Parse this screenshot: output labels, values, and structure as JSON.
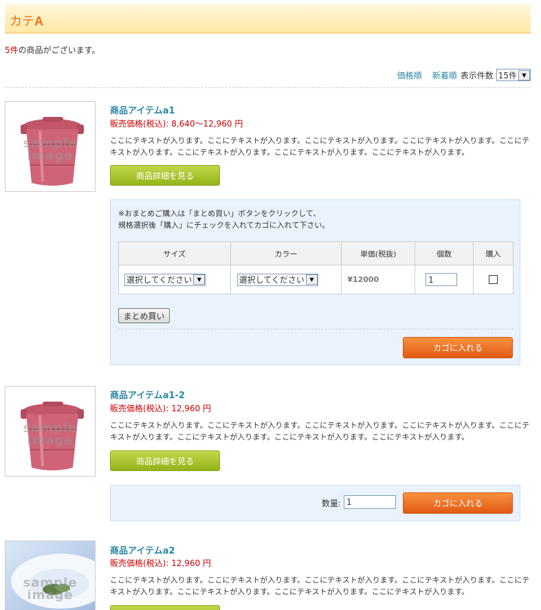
{
  "category": {
    "title_main": "カテ",
    "title_bold": "A"
  },
  "listing": {
    "count": "5件",
    "count_suffix": "の商品がございます。"
  },
  "sort": {
    "price_order": "価格順",
    "new_order": "新着順",
    "display_count_label": "表示件数",
    "display_count_value": "15件"
  },
  "products": [
    {
      "name": "商品アイテムa1",
      "price": "販売価格(税込): 8,640～12,960 円",
      "description": "ここにテキストが入ります。ここにテキストが入ります。ここにテキストが入ります。ここにテキストが入ります。ここにテキストが入ります。ここにテキストが入ります。ここにテキストが入ります。ここにテキストが入ります。",
      "detail_button": "商品詳細を見る",
      "image_watermark": [
        "sample",
        "image"
      ],
      "notice_line1": "※おまとめご購入は「まとめ買い」ボタンをクリックして、",
      "notice_line2": "規格選択後「購入」にチェックを入れてカゴに入れて下さい。",
      "table_headers": [
        "サイズ",
        "カラー",
        "単価(税抜)",
        "個数",
        "購入"
      ],
      "row": {
        "size_select": "選択してください",
        "color_select": "選択してください",
        "unit_price": "¥12000",
        "quantity": "1"
      },
      "bulk_button": "まとめ買い",
      "cart_button": "カゴに入れる"
    },
    {
      "name": "商品アイテムa1-2",
      "price": "販売価格(税込): 12,960 円",
      "description": "ここにテキストが入ります。ここにテキストが入ります。ここにテキストが入ります。ここにテキストが入ります。ここにテキストが入ります。ここにテキストが入ります。ここにテキストが入ります。ここにテキストが入ります。",
      "detail_button": "商品詳細を見る",
      "image_watermark": [
        "sample",
        "image"
      ],
      "quantity_label": "数量:",
      "quantity": "1",
      "cart_button": "カゴに入れる"
    },
    {
      "name": "商品アイテムa2",
      "price": "販売価格(税込): 12,960 円",
      "description": "ここにテキストが入ります。ここにテキストが入ります。ここにテキストが入ります。ここにテキストが入ります。ここにテキストが入ります。ここにテキストが入ります。ここにテキストが入ります。ここにテキストが入ります。",
      "image_watermark": [
        "sample",
        "image"
      ]
    }
  ],
  "colors": {
    "accent_orange": "#ef6f14",
    "link_blue": "#2b86a3",
    "price_red": "#cc0000",
    "detail_green": "#a8c62c",
    "cart_orange": "#f07a2a"
  }
}
